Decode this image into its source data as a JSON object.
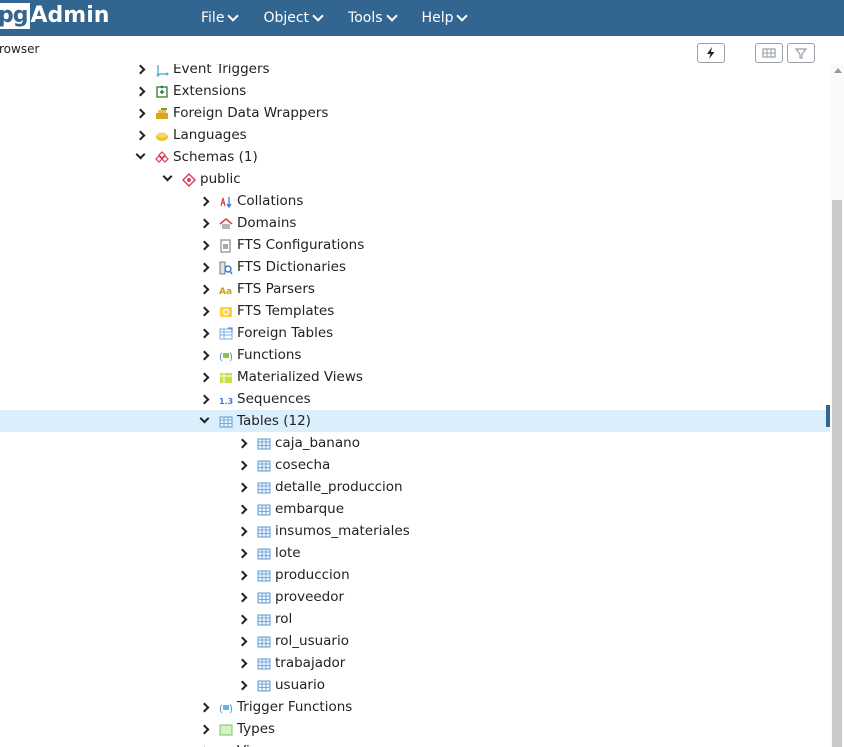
{
  "app": {
    "brand_pg": "pg",
    "brand_admin": "Admin"
  },
  "menu": [
    {
      "label": "File"
    },
    {
      "label": "Object"
    },
    {
      "label": "Tools"
    },
    {
      "label": "Help"
    }
  ],
  "panel": {
    "title": "rowser"
  },
  "toolbar": {
    "query_tool_icon": "lightning-icon",
    "view_data_icon": "grid-icon",
    "filter_icon": "filter-icon"
  },
  "colors": {
    "header": "#326690",
    "selected_row": "#dbeefc",
    "icon_table": "#5b9bd5"
  },
  "tree": [
    {
      "label": "Event Triggers",
      "level": 1,
      "toggle": "closed",
      "icon": "event-trigger-icon"
    },
    {
      "label": "Extensions",
      "level": 1,
      "toggle": "closed",
      "icon": "extension-icon"
    },
    {
      "label": "Foreign Data Wrappers",
      "level": 1,
      "toggle": "closed",
      "icon": "foreign-data-wrapper-icon"
    },
    {
      "label": "Languages",
      "level": 1,
      "toggle": "closed",
      "icon": "language-icon"
    },
    {
      "label": "Schemas (1)",
      "level": 1,
      "toggle": "open",
      "icon": "schemas-icon"
    },
    {
      "label": "public",
      "level": 2,
      "toggle": "open",
      "icon": "schema-icon"
    },
    {
      "label": "Collations",
      "level": 3,
      "toggle": "closed",
      "icon": "collation-icon"
    },
    {
      "label": "Domains",
      "level": 3,
      "toggle": "closed",
      "icon": "domain-icon"
    },
    {
      "label": "FTS Configurations",
      "level": 3,
      "toggle": "closed",
      "icon": "fts-configuration-icon"
    },
    {
      "label": "FTS Dictionaries",
      "level": 3,
      "toggle": "closed",
      "icon": "fts-dictionary-icon"
    },
    {
      "label": "FTS Parsers",
      "level": 3,
      "toggle": "closed",
      "icon": "fts-parser-icon"
    },
    {
      "label": "FTS Templates",
      "level": 3,
      "toggle": "closed",
      "icon": "fts-template-icon"
    },
    {
      "label": "Foreign Tables",
      "level": 3,
      "toggle": "closed",
      "icon": "foreign-table-icon"
    },
    {
      "label": "Functions",
      "level": 3,
      "toggle": "closed",
      "icon": "function-icon"
    },
    {
      "label": "Materialized Views",
      "level": 3,
      "toggle": "closed",
      "icon": "materialized-view-icon"
    },
    {
      "label": "Sequences",
      "level": 3,
      "toggle": "closed",
      "icon": "sequence-icon"
    },
    {
      "label": "Tables (12)",
      "level": 3,
      "toggle": "open",
      "icon": "tables-icon",
      "selected": true
    },
    {
      "label": "caja_banano",
      "level": 4,
      "toggle": "closed",
      "icon": "table-icon"
    },
    {
      "label": "cosecha",
      "level": 4,
      "toggle": "closed",
      "icon": "table-icon"
    },
    {
      "label": "detalle_produccion",
      "level": 4,
      "toggle": "closed",
      "icon": "table-icon"
    },
    {
      "label": "embarque",
      "level": 4,
      "toggle": "closed",
      "icon": "table-icon"
    },
    {
      "label": "insumos_materiales",
      "level": 4,
      "toggle": "closed",
      "icon": "table-icon"
    },
    {
      "label": "lote",
      "level": 4,
      "toggle": "closed",
      "icon": "table-icon"
    },
    {
      "label": "produccion",
      "level": 4,
      "toggle": "closed",
      "icon": "table-icon"
    },
    {
      "label": "proveedor",
      "level": 4,
      "toggle": "closed",
      "icon": "table-icon"
    },
    {
      "label": "rol",
      "level": 4,
      "toggle": "closed",
      "icon": "table-icon"
    },
    {
      "label": "rol_usuario",
      "level": 4,
      "toggle": "closed",
      "icon": "table-icon"
    },
    {
      "label": "trabajador",
      "level": 4,
      "toggle": "closed",
      "icon": "table-icon"
    },
    {
      "label": "usuario",
      "level": 4,
      "toggle": "closed",
      "icon": "table-icon"
    },
    {
      "label": "Trigger Functions",
      "level": 3,
      "toggle": "closed",
      "icon": "trigger-function-icon"
    },
    {
      "label": "Types",
      "level": 3,
      "toggle": "closed",
      "icon": "type-icon"
    },
    {
      "label": "Views",
      "level": 3,
      "toggle": "closed",
      "icon": "view-icon"
    }
  ]
}
